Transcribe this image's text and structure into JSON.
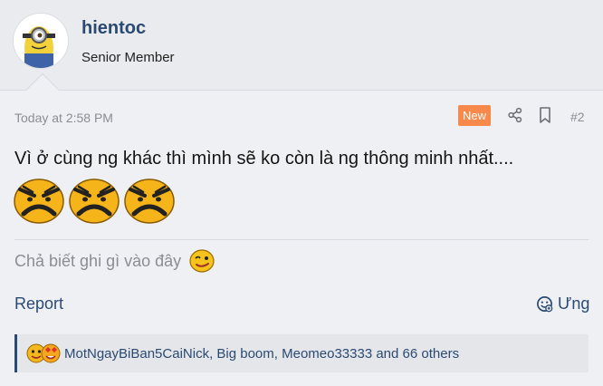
{
  "user": {
    "name": "hientoc",
    "title": "Senior Member"
  },
  "meta": {
    "timestamp": "Today at 2:58 PM",
    "badge": "New",
    "post_number": "#2"
  },
  "post": {
    "text": "Vì ở cùng ng khác thì mình sẽ ko còn là ng thông minh nhất....",
    "emoji_icons": [
      "angry-face-icon",
      "angry-face-icon",
      "angry-face-icon"
    ]
  },
  "signature": {
    "text": "Chả biết ghi gì vào đây",
    "emoji": "smiley-icon"
  },
  "actions": {
    "report": "Report",
    "react": "Ưng"
  },
  "reactions": {
    "users": "MotNgayBiBan5CaiNick, Big boom, Meomeo33333 and 66 others"
  },
  "colors": {
    "accent": "#2b4a72",
    "badge": "#f7894a",
    "muted": "#8a8d93",
    "background": "#eef0f3"
  }
}
